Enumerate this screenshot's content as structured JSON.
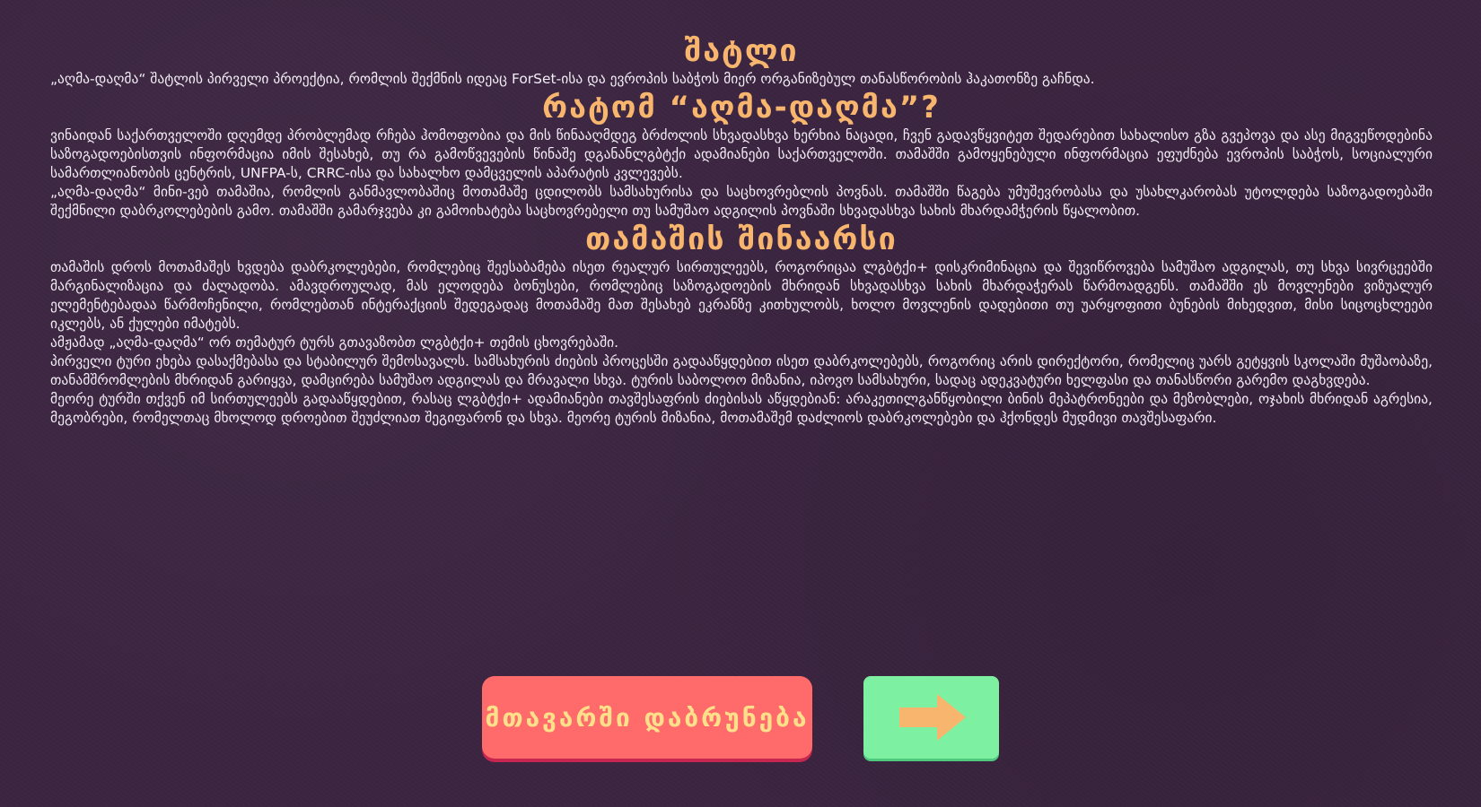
{
  "sections": {
    "about_title": "შატლი",
    "about_text": "„აღმა-დაღმა“ შატლის პირველი პროექტია, რომლის შექმნის იდეაც ForSet-ისა და ევროპის საბჭოს მიერ ორგანიზებულ თანასწორობის ჰაკათონზე გაჩნდა.",
    "why_title": "რატომ “აღმა-დაღმა”?",
    "why_text_1": "ვინაიდან საქართველოში დღემდე პრობლემად რჩება ჰომოფობია და მის წინააღმდეგ ბრძოლის სხვადასხვა ხერხია ნაცადი, ჩვენ გადავწყვიტეთ შედარებით სახალისო გზა გვეპოვა და ასე მიგვეწოდებინა საზოგადოებისთვის ინფორმაცია იმის შესახებ, თუ რა გამოწვევების წინაშე დგანანლგბტქი ადამიანები საქართველოში. თამაშში გამოყენებული ინფორმაცია ეფუძნება ევროპის საბჭოს, სოციალური სამართლიანობის ცენტრის, UNFPA-ს, CRRC-ისა და სახალხო დამცველის აპარატის კვლევებს.",
    "why_text_2": "„აღმა-დაღმა“ მინი-ვებ თამაშია, რომლის განმავლობაშიც მოთამაშე ცდილობს სამსახურისა და საცხოვრებლის პოვნას. თამაშში წაგება უმუშევრობასა და უსახლკარობას უტოლდება საზოგადოებაში შექმნილი დაბრკოლებების გამო. თამაშში გამარჯვება კი გამოიხატება საცხოვრებელი თუ სამუშაო ადგილის პოვნაში სხვადასხვა სახის მხარდამჭერის წყალობით.",
    "content_title": "თამაშის შინაარსი",
    "content_text_1": "თამაშის დროს მოთამაშეს ხვდება დაბრკოლებები, რომლებიც შეესაბამება ისეთ რეალურ სირთულეებს, როგორიცაა ლგბტქი+ დისკრიმინაცია და შევიწროვება სამუშაო ადგილას, თუ სხვა სივრცეებში მარგინალიზაცია და ძალადობა. ამავდროულად, მას ელოდება ბონუსები, რომლებიც საზოგადოების მხრიდან სხვადასხვა სახის მხარდაჭერას წარმოადგენს. თამაშში ეს მოვლენები ვიზუალურ ელემენტებადაა წარმოჩენილი, რომლებთან ინტერაქციის შედეგადაც მოთამაშე მათ შესახებ ეკრანზე კითხულობს, ხოლო მოვლენის დადებითი თუ უარყოფითი ბუნების მიხედვით, მისი სიცოცხლეები იკლებს, ან ქულები იმატებს.",
    "content_text_2": "ამჟამად „აღმა-დაღმა“ ორ თემატურ ტურს გთავაზობთ ლგბტქი+ თემის ცხოვრებაში.",
    "content_text_3": "პირველი ტური ეხება დასაქმებასა და სტაბილურ შემოსავალს. სამსახურის ძიების პროცესში გადააწყდებით ისეთ დაბრკოლებებს, როგორიც არის დირექტორი, რომელიც უარს გეტყვის სკოლაში მუშაობაზე, თანამშრომლების მხრიდან გარიყვა, დამცირება სამუშაო ადგილას და მრავალი სხვა. ტურის საბოლოო მიზანია, იპოვო სამსახური, სადაც ადეკვატური ხელფასი და თანასწორი გარემო დაგხვდება.",
    "content_text_4": "მეორე ტურში თქვენ იმ სირთულეებს გადააწყდებით, რასაც ლგბტქი+ ადამიანები თავშესაფრის ძიებისას აწყდებიან: არაკეთილგანწყობილი ბინის მეპატრონეები და მეზობლები, ოჯახის მხრიდან აგრესია, მეგობრები, რომელთაც მხოლოდ დროებით შეუძლიათ შეგიფარონ და სხვა. მეორე ტურის მიზანია, მოთამაშემ დაძლიოს დაბრკოლებები და ჰქონდეს მუდმივი თავშესაფარი."
  },
  "buttons": {
    "back_label": "მთავარში დაბრუნება",
    "next_icon": "arrow-right-icon"
  },
  "colors": {
    "background": "#3b2440",
    "heading": "#f7b56d",
    "body_text": "#f3eef6",
    "back_button": "#ff6b6b",
    "back_button_text": "#ffe08a",
    "next_button": "#7ef0a2",
    "arrow": "#f7b56d"
  }
}
